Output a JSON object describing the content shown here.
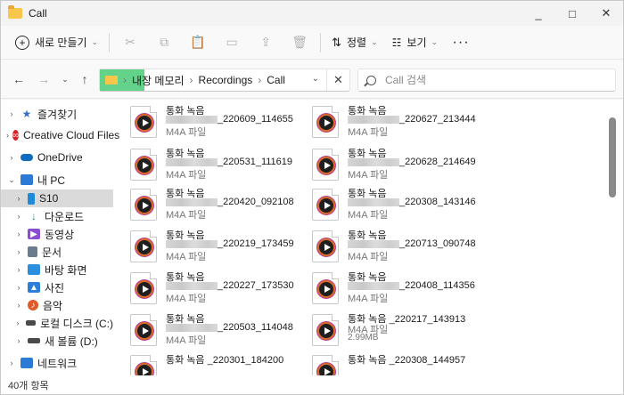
{
  "window": {
    "title": "Call",
    "controls": [
      "_",
      "□",
      "✕"
    ]
  },
  "toolbar": {
    "new_label": "새로 만들기",
    "sort_label": "정렬",
    "view_label": "보기",
    "more_label": "···"
  },
  "address": {
    "crumbs": [
      "내장 메모리",
      "Recordings",
      "Call"
    ],
    "search_placeholder": "Call 검색"
  },
  "nav": {
    "items": [
      {
        "label": "즐겨찾기",
        "icon": "star-icon",
        "color": "#3a6ec6"
      },
      {
        "label": "Creative Cloud Files",
        "icon": "creative-cloud-icon",
        "color": "#da1f26"
      },
      {
        "label": "OneDrive",
        "icon": "cloud-icon",
        "color": "#0f6cbd"
      },
      {
        "label": "내 PC",
        "icon": "pc-icon",
        "color": "#2a7ad6"
      },
      {
        "label": "S10",
        "icon": "phone-icon",
        "color": "#1e8ad8"
      },
      {
        "label": "다운로드",
        "icon": "download-icon",
        "color": "#1e9b61"
      },
      {
        "label": "동영상",
        "icon": "video-icon",
        "color": "#8a4fd0"
      },
      {
        "label": "문서",
        "icon": "document-icon",
        "color": "#6b7c8f"
      },
      {
        "label": "바탕 화면",
        "icon": "desktop-icon",
        "color": "#2b8fe0"
      },
      {
        "label": "사진",
        "icon": "pictures-icon",
        "color": "#2b7fd8"
      },
      {
        "label": "음악",
        "icon": "music-icon",
        "color": "#e05a2a"
      },
      {
        "label": "로컬 디스크 (C:)",
        "icon": "drive-icon",
        "color": "#4a4a4a"
      },
      {
        "label": "새 볼륨 (D:)",
        "icon": "drive-icon",
        "color": "#4a4a4a"
      },
      {
        "label": "네트워크",
        "icon": "network-icon",
        "color": "#2a7ad6"
      }
    ]
  },
  "files": [
    {
      "name1": "통화 녹음",
      "suffix": "_220609_114655",
      "type": "M4A 파일",
      "size": ""
    },
    {
      "name1": "통화 녹음",
      "suffix": "_220627_213444",
      "type": "M4A 파일",
      "size": ""
    },
    {
      "name1": "통화 녹음",
      "suffix": "_220531_111619",
      "type": "M4A 파일",
      "size": ""
    },
    {
      "name1": "통화 녹음",
      "suffix": "_220628_214649",
      "type": "M4A 파일",
      "size": ""
    },
    {
      "name1": "통화 녹음",
      "suffix": "_220420_092108",
      "type": "M4A 파일",
      "size": ""
    },
    {
      "name1": "통화 녹음",
      "suffix": "_220308_143146",
      "type": "M4A 파일",
      "size": ""
    },
    {
      "name1": "통화 녹음",
      "suffix": "_220219_173459",
      "type": "M4A 파일",
      "size": ""
    },
    {
      "name1": "통화 녹음",
      "suffix": "_220713_090748",
      "type": "M4A 파일",
      "size": ""
    },
    {
      "name1": "통화 녹음",
      "suffix": "_220227_173530",
      "type": "M4A 파일",
      "size": ""
    },
    {
      "name1": "통화 녹음",
      "suffix": "_220408_114356",
      "type": "M4A 파일",
      "size": ""
    },
    {
      "name1": "통화 녹음",
      "suffix": "_220503_114048",
      "type": "M4A 파일",
      "size": ""
    },
    {
      "name1": "통화 녹음 _220217_143913",
      "suffix": "",
      "type": "M4A 파일",
      "size": "2.99MB"
    },
    {
      "name1": "통화 녹음 _220301_184200",
      "suffix": "",
      "type": "",
      "size": ""
    },
    {
      "name1": "통화 녹음 _220308_144957",
      "suffix": "",
      "type": "",
      "size": ""
    }
  ],
  "status": {
    "count": "40개 항목"
  }
}
